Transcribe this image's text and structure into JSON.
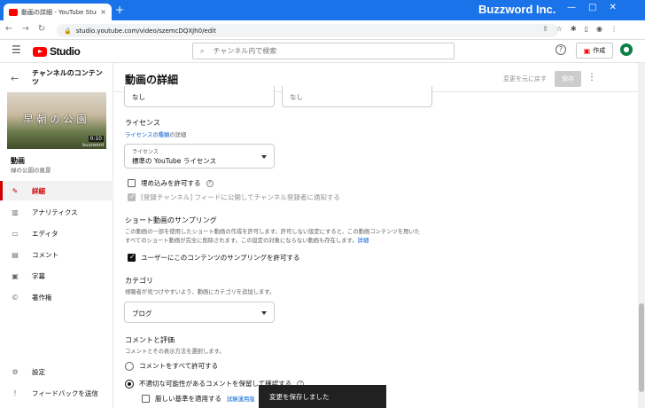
{
  "browser": {
    "tab_title": "動画の詳細 - YouTube Studio",
    "tab_close": "×",
    "new_tab": "+",
    "url": "studio.youtube.com/video/szemcDQXJh0/edit",
    "brand": "Buzzword Inc.",
    "win_min": "—",
    "win_max": "□",
    "win_close": "✕"
  },
  "header": {
    "logo_text": "Studio",
    "search_placeholder": "チャンネル内で検索",
    "help": "?",
    "create_label": "作成"
  },
  "sidebar": {
    "channel_title": "チャンネルのコンテンツ",
    "thumb_text": "早朝の公園",
    "thumb_duration": "0:10",
    "thumb_footer": "buzzword",
    "video_label": "動画",
    "video_title": "緑の公園の風景",
    "items": [
      {
        "label": "詳細",
        "icon": "✎"
      },
      {
        "label": "アナリティクス",
        "icon": "▥"
      },
      {
        "label": "エディタ",
        "icon": "▭"
      },
      {
        "label": "コメント",
        "icon": "▤"
      },
      {
        "label": "字幕",
        "icon": "▣"
      },
      {
        "label": "著作権",
        "icon": "©"
      }
    ],
    "settings_label": "設定",
    "feedback_label": "フィードバックを送信"
  },
  "main": {
    "page_title": "動画の詳細",
    "undo_label": "変更を元に戻す",
    "save_label": "保存",
    "top_field_left": "なし",
    "top_field_right": "なし",
    "license": {
      "title": "ライセンス",
      "link_text": "ライセンスの種類",
      "link_suffix": "の詳細",
      "field_label": "ライセンス",
      "field_value": "標準の YouTube ライセンス"
    },
    "embed_label": "埋め込みを許可する",
    "publish_feed_label": "[登録チャンネル] フィードに公開してチャンネル登録者に通知する",
    "shorts": {
      "title": "ショート動画のサンプリング",
      "desc1": "この動画の一部を使用したショート動画の作成を許可します。許可しない設定にすると、この動画コンテンツを用いた",
      "desc2": "すべてのショート動画が完全に削除されます。この設定の対象にならない動画も存在します。",
      "detail_link": "詳細",
      "checkbox_label": "ユーザーにこのコンテンツのサンプリングを許可する"
    },
    "category": {
      "title": "カテゴリ",
      "desc": "視聴者が見つけやすいよう、動画にカテゴリを追加します。",
      "value": "ブログ"
    },
    "comments": {
      "title": "コメントと評価",
      "desc": "コメントとその表示方法を選択します。",
      "option_all": "コメントをすべて許可する",
      "option_hold": "不適切な可能性があるコメントを保留して確認する",
      "strict_label": "厳しい基準を適用する",
      "strict_badge": "試験運用版"
    }
  },
  "snackbar": "変更を保存しました",
  "colors": {
    "accent": "#1a73e8",
    "youtube_red": "#ff0000",
    "active_nav": "#cc0000",
    "link": "#065fd4"
  }
}
